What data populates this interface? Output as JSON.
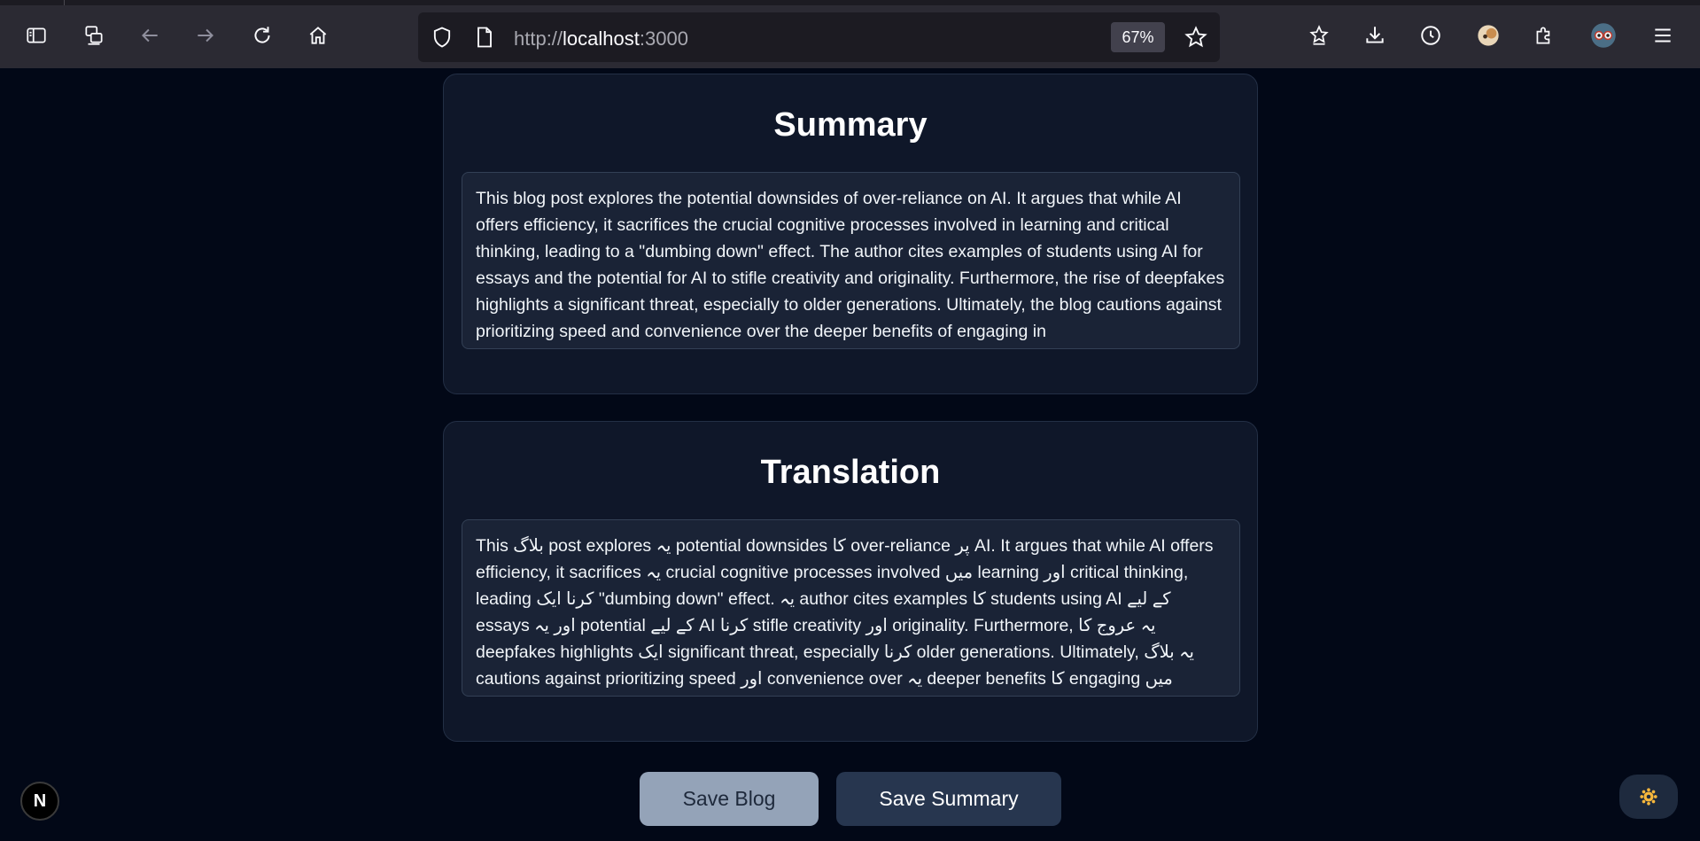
{
  "browser": {
    "url_scheme": "http://",
    "url_host": "localhost",
    "url_port": ":3000",
    "zoom": "67%",
    "icons": {
      "sidebar": "sidebar-icon",
      "sync": "sync-icon",
      "back": "back-arrow-icon",
      "forward": "forward-arrow-icon",
      "reload": "reload-icon",
      "home": "home-icon",
      "shield": "shield-icon",
      "page": "page-icon",
      "bookmark": "star-icon",
      "bookmarks_toolbar": "star-list-icon",
      "downloads": "download-icon",
      "history": "history-icon",
      "extensions": "puzzle-icon",
      "menu": "hamburger-menu-icon"
    }
  },
  "summary": {
    "title": "Summary",
    "text": "This blog post explores the potential downsides of over-reliance on AI.  It argues that while AI offers efficiency, it sacrifices the crucial cognitive processes involved in learning and critical thinking, leading to a \"dumbing down\" effect.  The author cites examples of students using AI for essays and the potential for AI to stifle creativity and originality.  Furthermore, the rise of deepfakes highlights a significant threat, especially to older generations.  Ultimately, the blog cautions against prioritizing speed and convenience over the deeper benefits of engaging in"
  },
  "translation": {
    "title": "Translation",
    "text": "This بلاگ post explores یہ potential downsides کا over-reliance پر AI.  It argues that while AI offers efficiency, it sacrifices یہ crucial cognitive processes involved میں learning اور critical thinking, leading کرنا ایک \"dumbing down\" effect.  یہ author cites examples کا students using AI کے لیے essays اور یہ potential کے لیے AI کرنا stifle creativity اور originality.  Furthermore, یہ عروج کا deepfakes highlights ایک significant threat, especially کرنا older generations.  Ultimately, یہ بلاگ cautions against prioritizing speed اور convenience over یہ deeper benefits کا engaging میں"
  },
  "actions": {
    "save_blog": "Save Blog",
    "save_summary": "Save Summary"
  },
  "dev_badge": "N",
  "colors": {
    "page_bg": "#020817",
    "card_bg": "#0f1729",
    "save_blog_bg": "#94a3b8",
    "save_summary_bg": "#27364f"
  }
}
